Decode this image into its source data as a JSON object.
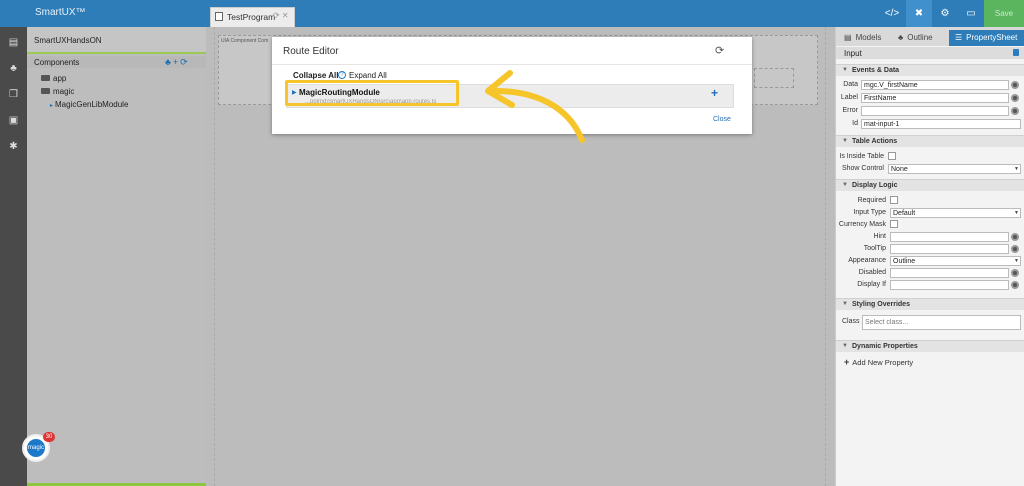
{
  "app": {
    "brand": "SmartUX™",
    "save_label": "Save"
  },
  "doc_tab": {
    "label": "TestProgram"
  },
  "project": {
    "name": "SmartUXHandsON"
  },
  "components": {
    "title": "Components",
    "tree": [
      {
        "label": "app",
        "kind": "folder"
      },
      {
        "label": "magic",
        "kind": "folder"
      },
      {
        "label": "MagicGenLibModule",
        "kind": "module"
      }
    ]
  },
  "canvas": {
    "frame_label": "UIA Component Com"
  },
  "modal": {
    "title": "Route Editor",
    "collapse_all": "Collapse All",
    "help_glyph": "?",
    "expand_all": "Expand All",
    "route": {
      "name": "MagicRoutingModule",
      "path": "...pplmd\\SmartUXHandsON\\src\\app\\app.routes.ts",
      "add_glyph": "+"
    },
    "close": "Close"
  },
  "right_panel": {
    "tabs": [
      {
        "label": "Models"
      },
      {
        "label": "Outline"
      },
      {
        "label": "PropertySheet"
      }
    ],
    "input_title": "Input",
    "sections": {
      "events": "Events & Data",
      "table": "Table Actions",
      "display": "Display Logic",
      "styling": "Styling Overrides",
      "dynamic": "Dynamic Properties"
    },
    "props": {
      "data": {
        "label": "Data",
        "value": "mgc.V_firstName"
      },
      "label": {
        "label": "Label",
        "value": "FirstName"
      },
      "error": {
        "label": "Error",
        "value": ""
      },
      "id": {
        "label": "Id",
        "value": "mat-input-1"
      },
      "inside_table": {
        "label": "Is Inside Table"
      },
      "show_control": {
        "label": "Show Control",
        "value": "None"
      },
      "required": {
        "label": "Required"
      },
      "input_type": {
        "label": "Input Type",
        "value": "Default"
      },
      "currency_mask": {
        "label": "Currency Mask"
      },
      "hint": {
        "label": "Hint",
        "value": ""
      },
      "tooltip": {
        "label": "ToolTip",
        "value": ""
      },
      "appearance": {
        "label": "Appearance",
        "value": "Outline"
      },
      "disabled": {
        "label": "Disabled",
        "value": ""
      },
      "display_if": {
        "label": "Display If",
        "value": ""
      },
      "class": {
        "label": "Class",
        "placeholder": "Select class..."
      }
    },
    "add_property": "Add New Property"
  },
  "badge": {
    "count": "30",
    "text": "magic"
  },
  "colors": {
    "accent": "#2e7db8",
    "highlight": "#f6c52a",
    "save": "#5bb55e"
  }
}
